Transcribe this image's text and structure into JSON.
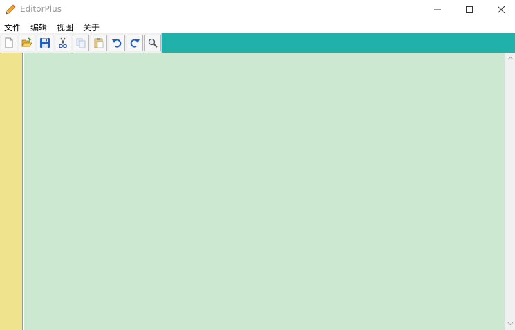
{
  "window": {
    "title": "EditorPlus",
    "icon": "pencil-icon"
  },
  "controls": {
    "minimize_icon": "minimize-icon",
    "maximize_icon": "maximize-icon",
    "close_icon": "close-icon"
  },
  "menu": {
    "file": "文件",
    "edit": "编辑",
    "view": "视图",
    "about": "关于"
  },
  "toolbar": {
    "buttons": [
      {
        "icon": "new-file-icon"
      },
      {
        "icon": "open-folder-icon"
      },
      {
        "icon": "save-icon"
      },
      {
        "icon": "cut-icon"
      },
      {
        "icon": "copy-icon"
      },
      {
        "icon": "paste-icon"
      },
      {
        "icon": "undo-icon"
      },
      {
        "icon": "redo-icon"
      },
      {
        "icon": "search-icon"
      }
    ]
  },
  "editor": {
    "content": ""
  },
  "colors": {
    "toolbar_band": "#20b2aa",
    "gutter": "#f0e38d",
    "editor_background": "#cde8d0"
  }
}
